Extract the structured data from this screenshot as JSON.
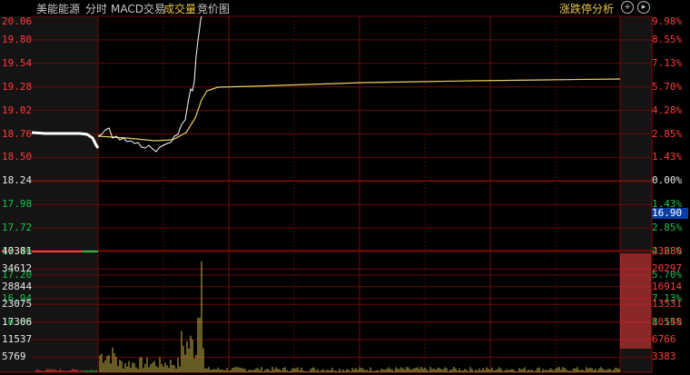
{
  "topbar": {
    "stock_name": "美能能源",
    "tabs": [
      {
        "label": "分时",
        "active": false
      },
      {
        "label": "MACD交易",
        "active": false
      },
      {
        "label": "成交量",
        "active": true
      },
      {
        "label": "竞价图",
        "active": false
      }
    ],
    "analysis_button": "涨跌停分析",
    "add_icon": "+",
    "scroll_icon": "▸"
  },
  "close_icon": "×",
  "price_axis": {
    "left_labels": [
      "20.06",
      "19.80",
      "19.54",
      "19.28",
      "19.02",
      "18.76",
      "18.50",
      "18.24",
      "17.98",
      "17.72",
      "17.46",
      "17.20",
      "16.94",
      "16.68"
    ],
    "right_labels": [
      "9.98%",
      "8.55%",
      "7.13%",
      "5.70%",
      "4.28%",
      "2.85%",
      "1.43%",
      "0.00%",
      "1.43%",
      "2.85%",
      "4.28%",
      "5.70%",
      "7.13%",
      "8.55%"
    ],
    "current_price_tag": "16.90",
    "prev_close": 18.24
  },
  "volume_axis": {
    "left_labels": [
      "40381",
      "34612",
      "28844",
      "23075",
      "17306",
      "11537",
      "5769"
    ],
    "right_labels": [
      "23680",
      "20297",
      "16914",
      "13531",
      "10148",
      "6766",
      "3383"
    ]
  },
  "colors": {
    "price_line": "#ffffff",
    "avg_line": "#e8d25a",
    "grid": "#7a0a0a",
    "rise": "#ff3b3b",
    "fall": "#19c24a",
    "volume_bar": "#c9b64a",
    "current_tag_bg": "#0b3fa8"
  },
  "chart_data": [
    {
      "type": "line",
      "series": [],
      "y_range": [
        16.68,
        20.06
      ],
      "note_prev_close": 18.24
    },
    {
      "type": "bar",
      "y_range_left": [
        0,
        40381
      ],
      "y_range_right": [
        0,
        23680
      ],
      "peak_volume": 36000
    }
  ]
}
